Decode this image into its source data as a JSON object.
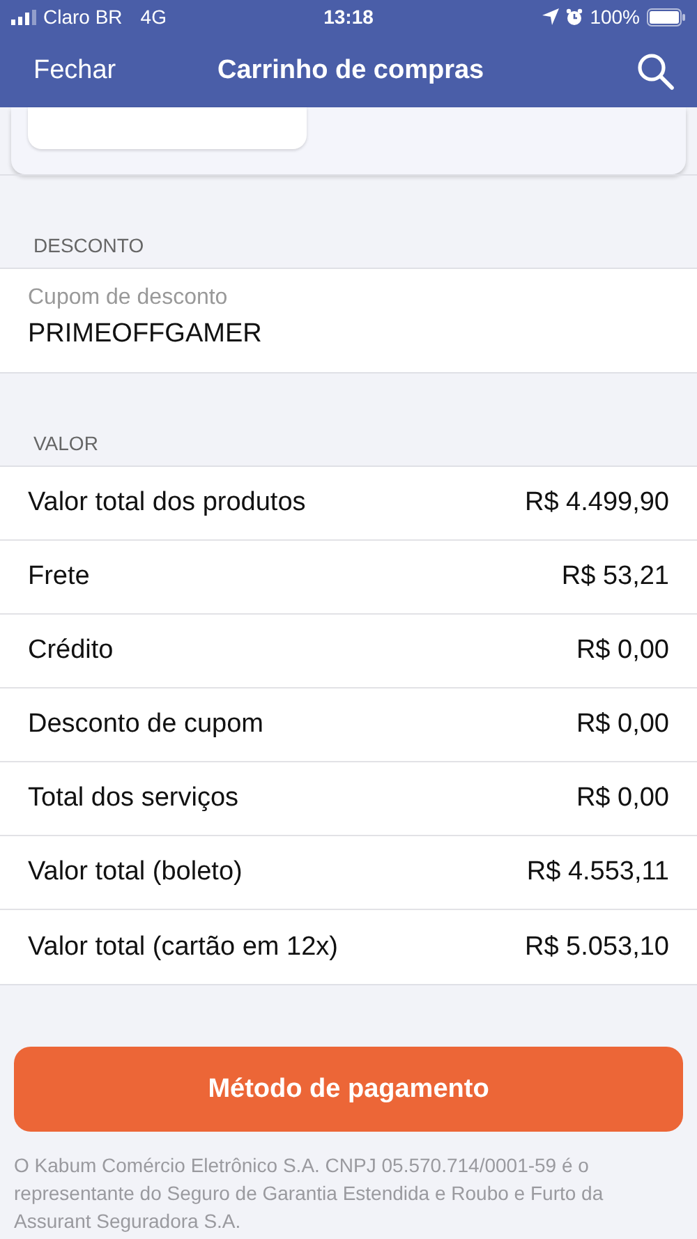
{
  "status_bar": {
    "carrier": "Claro BR",
    "network": "4G",
    "time": "13:18",
    "battery": "100%"
  },
  "nav_bar": {
    "left": "Fechar",
    "title": "Carrinho de compras"
  },
  "discount": {
    "header": "DESCONTO",
    "field": {
      "placeholder": "Cupom de desconto",
      "value": "PRIMEOFFGAMER"
    }
  },
  "value": {
    "header": "VALOR",
    "rows": [
      {
        "label": "Valor total dos produtos",
        "amount": "R$ 4.499,90"
      },
      {
        "label": "Frete",
        "amount": "R$ 53,21"
      },
      {
        "label": "Crédito",
        "amount": "R$ 0,00"
      },
      {
        "label": "Desconto de cupom",
        "amount": "R$ 0,00"
      },
      {
        "label": "Total dos serviços",
        "amount": "R$ 0,00"
      },
      {
        "label": "Valor total (boleto)",
        "amount": "R$ 4.553,11"
      },
      {
        "label": "Valor total (cartão em 12x)",
        "amount": "R$ 5.053,10"
      }
    ]
  },
  "payment_button": "Método de pagamento",
  "footer": "O Kabum Comércio Eletrônico S.A. CNPJ 05.570.714/0001-59 é o representante do Seguro de Garantia Estendida e Roubo e Furto da Assurant Seguradora S.A."
}
